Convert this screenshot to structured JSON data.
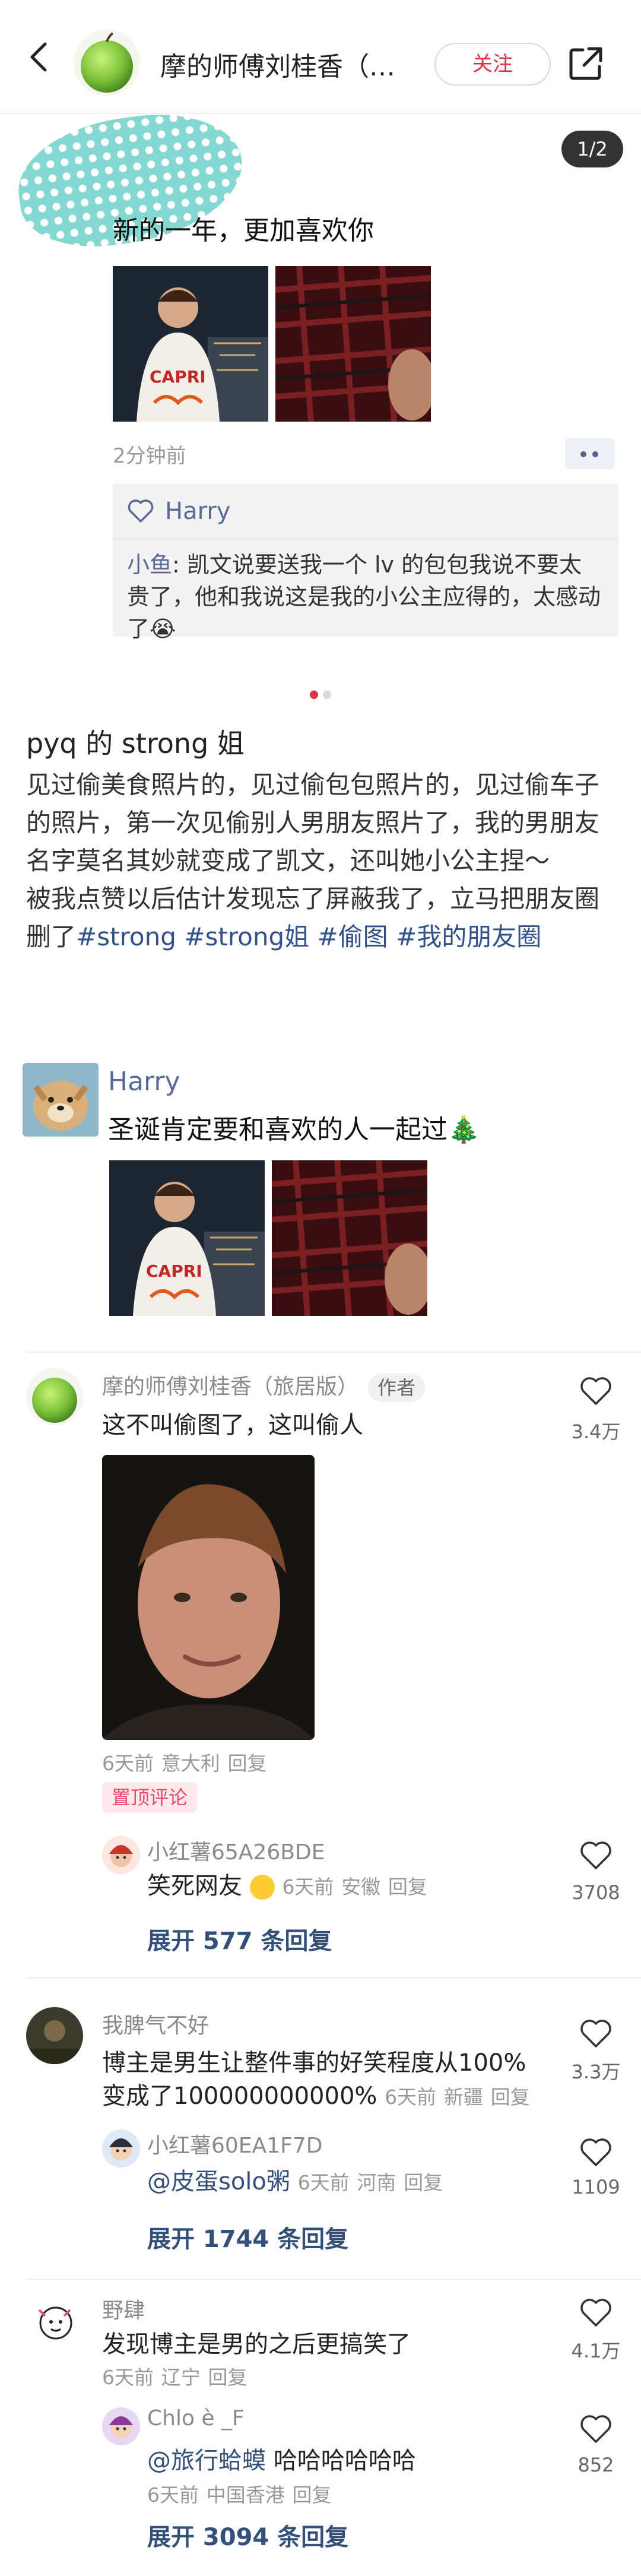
{
  "header": {
    "title": "摩的师傅刘桂香（…",
    "follow_label": "关注"
  },
  "screenshot": {
    "page_indicator": "1/2",
    "caption": "新的一年，更加喜欢你",
    "time": "2分钟前",
    "likes_name": "Harry",
    "reply_name": "小鱼",
    "reply_text": ": 凯文说要送我一个 lv 的包包我说不要太贵了，他和我说这是我的小公主应得的，太感动了😭"
  },
  "post": {
    "title": "pyq 的 strong 姐",
    "para1": "见过偷美食照片的，见过偷包包照片的，见过偷车子的照片，第一次见偷别人男朋友照片了，我的男朋友名字莫名其妙就变成了凯文，还叫她小公主捏～",
    "para2_text": "被我点赞以后估计发现忘了屏蔽我了，立马把朋友圈删了",
    "tags": [
      "#strong",
      "#strong姐",
      "#偷图",
      "#我的朋友圈"
    ]
  },
  "moment2": {
    "name": "Harry",
    "text": "圣诞肯定要和喜欢的人一起过🎄"
  },
  "comments": [
    {
      "name": "摩的师傅刘桂香（旅居版）",
      "badge": "作者",
      "text": "这不叫偷图了，这叫偷人",
      "meta_time": "6天前",
      "meta_loc": "意大利",
      "reply": "回复",
      "likes": "3.4万",
      "pin": "置顶评论",
      "sub": {
        "name": "小红薯65A26BDE",
        "text": "笑死网友",
        "meta_time": "6天前",
        "meta_loc": "安徽",
        "reply": "回复",
        "likes": "3708"
      },
      "expand": "展开 577 条回复"
    },
    {
      "name": "我脾气不好",
      "text1": "博主是男生让整件事的好笑程度从100%",
      "text2": "变成了100000000000%",
      "meta_time": "6天前",
      "meta_loc": "新疆",
      "reply": "回复",
      "likes": "3.3万",
      "sub": {
        "name": "小红薯60EA1F7D",
        "mention": "@皮蛋solo粥",
        "meta_time": "6天前",
        "meta_loc": "河南",
        "reply": "回复",
        "likes": "1109"
      },
      "expand": "展开 1744 条回复"
    },
    {
      "name": "野肆",
      "text": "发现博主是男的之后更搞笑了",
      "meta_time": "6天前",
      "meta_loc": "辽宁",
      "reply": "回复",
      "likes": "4.1万",
      "sub": {
        "name": "Chlo è _F",
        "mention": "@旅行蛤蟆",
        "text": " 哈哈哈哈哈哈",
        "meta_time": "6天前",
        "meta_loc": "中国香港",
        "reply": "回复",
        "likes": "852"
      },
      "expand": "展开 3094 条回复"
    }
  ],
  "colors": {
    "accent_red": "#e02e45",
    "link_blue": "#576b95",
    "tag_blue": "#32508a"
  }
}
